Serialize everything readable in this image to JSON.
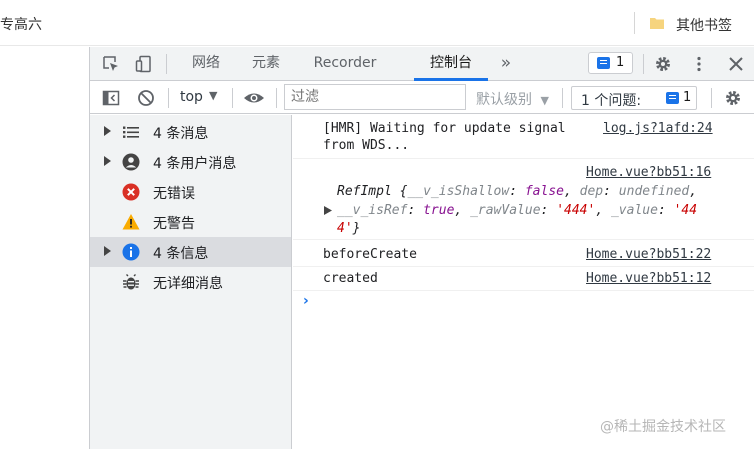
{
  "bookmarks": {
    "left_text": "专高六",
    "right_text": "其他书签"
  },
  "devtools": {
    "tabs": [
      "网络",
      "元素",
      "Recorder",
      "控制台"
    ],
    "more_tabs": "»",
    "message_badge_count": "1",
    "toolbar": {
      "context": "top",
      "filter_placeholder": "过滤",
      "levels_label": "默认级别",
      "issues_label": "1 个问题:",
      "issues_count": "1"
    },
    "sidebar": [
      {
        "label": "4 条消息",
        "icon": "list-icon",
        "expandable": true,
        "selected": false
      },
      {
        "label": "4 条用户消息",
        "icon": "user-icon",
        "expandable": true,
        "selected": false
      },
      {
        "label": "无错误",
        "icon": "error-icon",
        "expandable": false,
        "selected": false
      },
      {
        "label": "无警告",
        "icon": "warning-icon",
        "expandable": false,
        "selected": false
      },
      {
        "label": "4 条信息",
        "icon": "info-icon",
        "expandable": true,
        "selected": true
      },
      {
        "label": "无详细消息",
        "icon": "bug-icon",
        "expandable": false,
        "selected": false
      }
    ],
    "messages": [
      {
        "line1": "[HMR] Waiting for update signal",
        "line2": "from WDS...",
        "source": "log.js?1afd:24"
      },
      {
        "source": "Home.vue?bb51:16",
        "object_name": "RefImpl",
        "obj_line1": {
          "k1": "__v_isShallow",
          "v1": "false",
          "k2": "dep",
          "v2": "undefined"
        },
        "obj_line2": {
          "k1": "__v_isRef",
          "v1": "true",
          "k2": "_rawValue",
          "v2": "'444'",
          "k3": "_value",
          "v3": "'44"
        },
        "obj_line3": {
          "v3_cont": "4'",
          "close": "}"
        }
      },
      {
        "text": "beforeCreate",
        "source": "Home.vue?bb51:22"
      },
      {
        "text": "created",
        "source": "Home.vue?bb51:12"
      }
    ],
    "prompt": "›"
  },
  "watermark": "@稀土掘金技术社区",
  "colors": {
    "accent": "#1a73e8",
    "error": "#d93025",
    "warning": "#f9ab00",
    "info": "#1a73e8"
  }
}
